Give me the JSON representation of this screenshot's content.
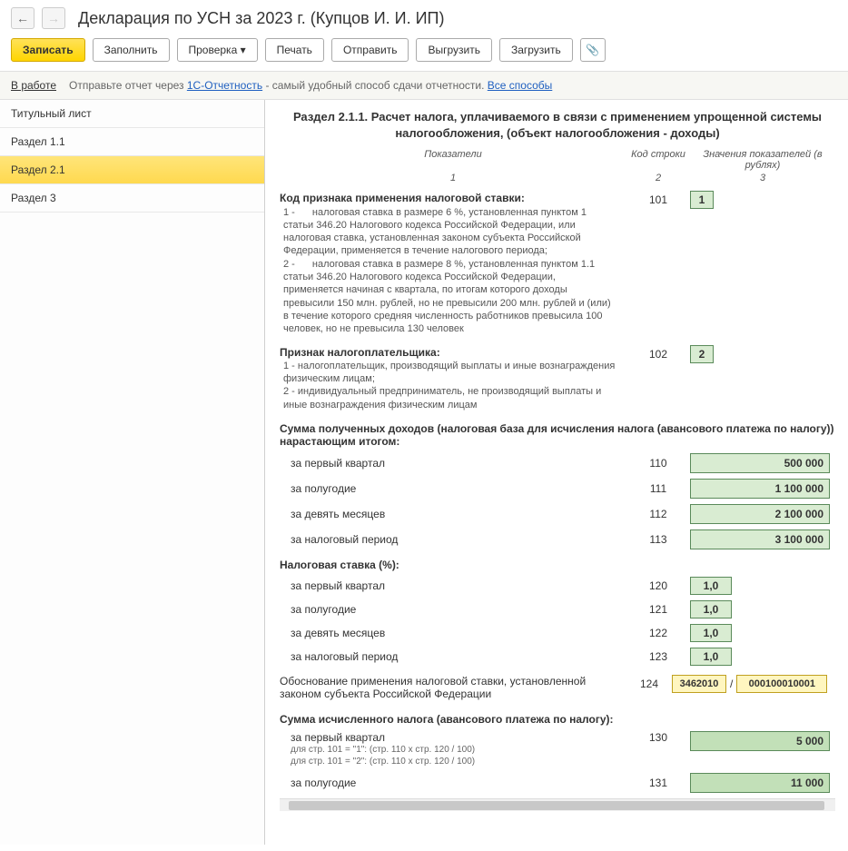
{
  "header": {
    "title": "Декларация по УСН за 2023 г. (Купцов И. И. ИП)"
  },
  "toolbar": {
    "save": "Записать",
    "fill": "Заполнить",
    "check": "Проверка",
    "print": "Печать",
    "send": "Отправить",
    "upload": "Выгрузить",
    "download": "Загрузить"
  },
  "status": {
    "label": "В работе",
    "text_before": "Отправьте отчет через ",
    "link1": "1С-Отчетность",
    "text_after": " - самый удобный способ сдачи отчетности. ",
    "link2": "Все способы"
  },
  "sidebar": {
    "items": [
      "Титульный лист",
      "Раздел 1.1",
      "Раздел 2.1",
      "Раздел 3"
    ],
    "active_index": 2
  },
  "section": {
    "title": "Раздел 2.1.1. Расчет налога, уплачиваемого в связи с применением упрощенной системы налогообложения, (объект налогообложения - доходы)",
    "col_headers": {
      "c1": "Показатели",
      "c2": "Код строки",
      "c3": "Значения показателей (в рублях)"
    },
    "col_nums": {
      "c1": "1",
      "c2": "2",
      "c3": "3"
    }
  },
  "rows": {
    "r101": {
      "label": "Код признака применения налоговой ставки:",
      "code": "101",
      "value": "1",
      "sub1_num": "1 -",
      "sub1": "налоговая ставка в размере 6 %, установленная пунктом 1 статьи 346.20 Налогового кодекса Российской Федерации, или налоговая ставка, установленная законом субъекта Российской Федерации, применяется в течение налогового периода;",
      "sub2_num": "2 -",
      "sub2": "налоговая ставка в размере 8 %, установленная пунктом 1.1 статьи 346.20 Налогового кодекса Российской Федерации, применяется начиная с квартала, по итогам которого доходы превысили 150 млн. рублей, но не превысили 200 млн. рублей и (или) в течение которого средняя численность работников превысила 100 человек, но не превысила 130 человек"
    },
    "r102": {
      "label": "Признак налогоплательщика:",
      "code": "102",
      "value": "2",
      "sub1_num": "1 -",
      "sub1": "налогоплательщик, производящий выплаты и иные вознаграждения физическим лицам;",
      "sub2_num": "2 -",
      "sub2": "индивидуальный предприниматель, не производящий выплаты и иные вознаграждения физическим лицам"
    },
    "income_header": "Сумма полученных доходов (налоговая база для исчисления налога (авансового платежа по налогу)) нарастающим итогом:",
    "r110": {
      "label": "за первый квартал",
      "code": "110",
      "value": "500 000"
    },
    "r111": {
      "label": "за полугодие",
      "code": "111",
      "value": "1 100 000"
    },
    "r112": {
      "label": "за девять месяцев",
      "code": "112",
      "value": "2 100 000"
    },
    "r113": {
      "label": "за налоговый период",
      "code": "113",
      "value": "3 100 000"
    },
    "rate_header": "Налоговая ставка (%):",
    "r120": {
      "label": "за первый квартал",
      "code": "120",
      "value": "1,0"
    },
    "r121": {
      "label": "за полугодие",
      "code": "121",
      "value": "1,0"
    },
    "r122": {
      "label": "за девять месяцев",
      "code": "122",
      "value": "1,0"
    },
    "r123": {
      "label": "за налоговый период",
      "code": "123",
      "value": "1,0"
    },
    "r124": {
      "label": "Обоснование применения налоговой ставки, установленной законом субъекта Российской Федерации",
      "code": "124",
      "value1": "3462010",
      "sep": "/",
      "value2": "000100010001"
    },
    "tax_header": "Сумма исчисленного налога (авансового платежа по налогу):",
    "r130": {
      "label": "за первый квартал",
      "hint1": "для стр. 101 = \"1\": (стр. 110 х стр. 120 / 100)",
      "hint2": "для стр. 101 = \"2\": (стр. 110 х стр. 120 / 100)",
      "code": "130",
      "value": "5 000"
    },
    "r131": {
      "label": "за полугодие",
      "code": "131",
      "value": "11 000"
    }
  }
}
